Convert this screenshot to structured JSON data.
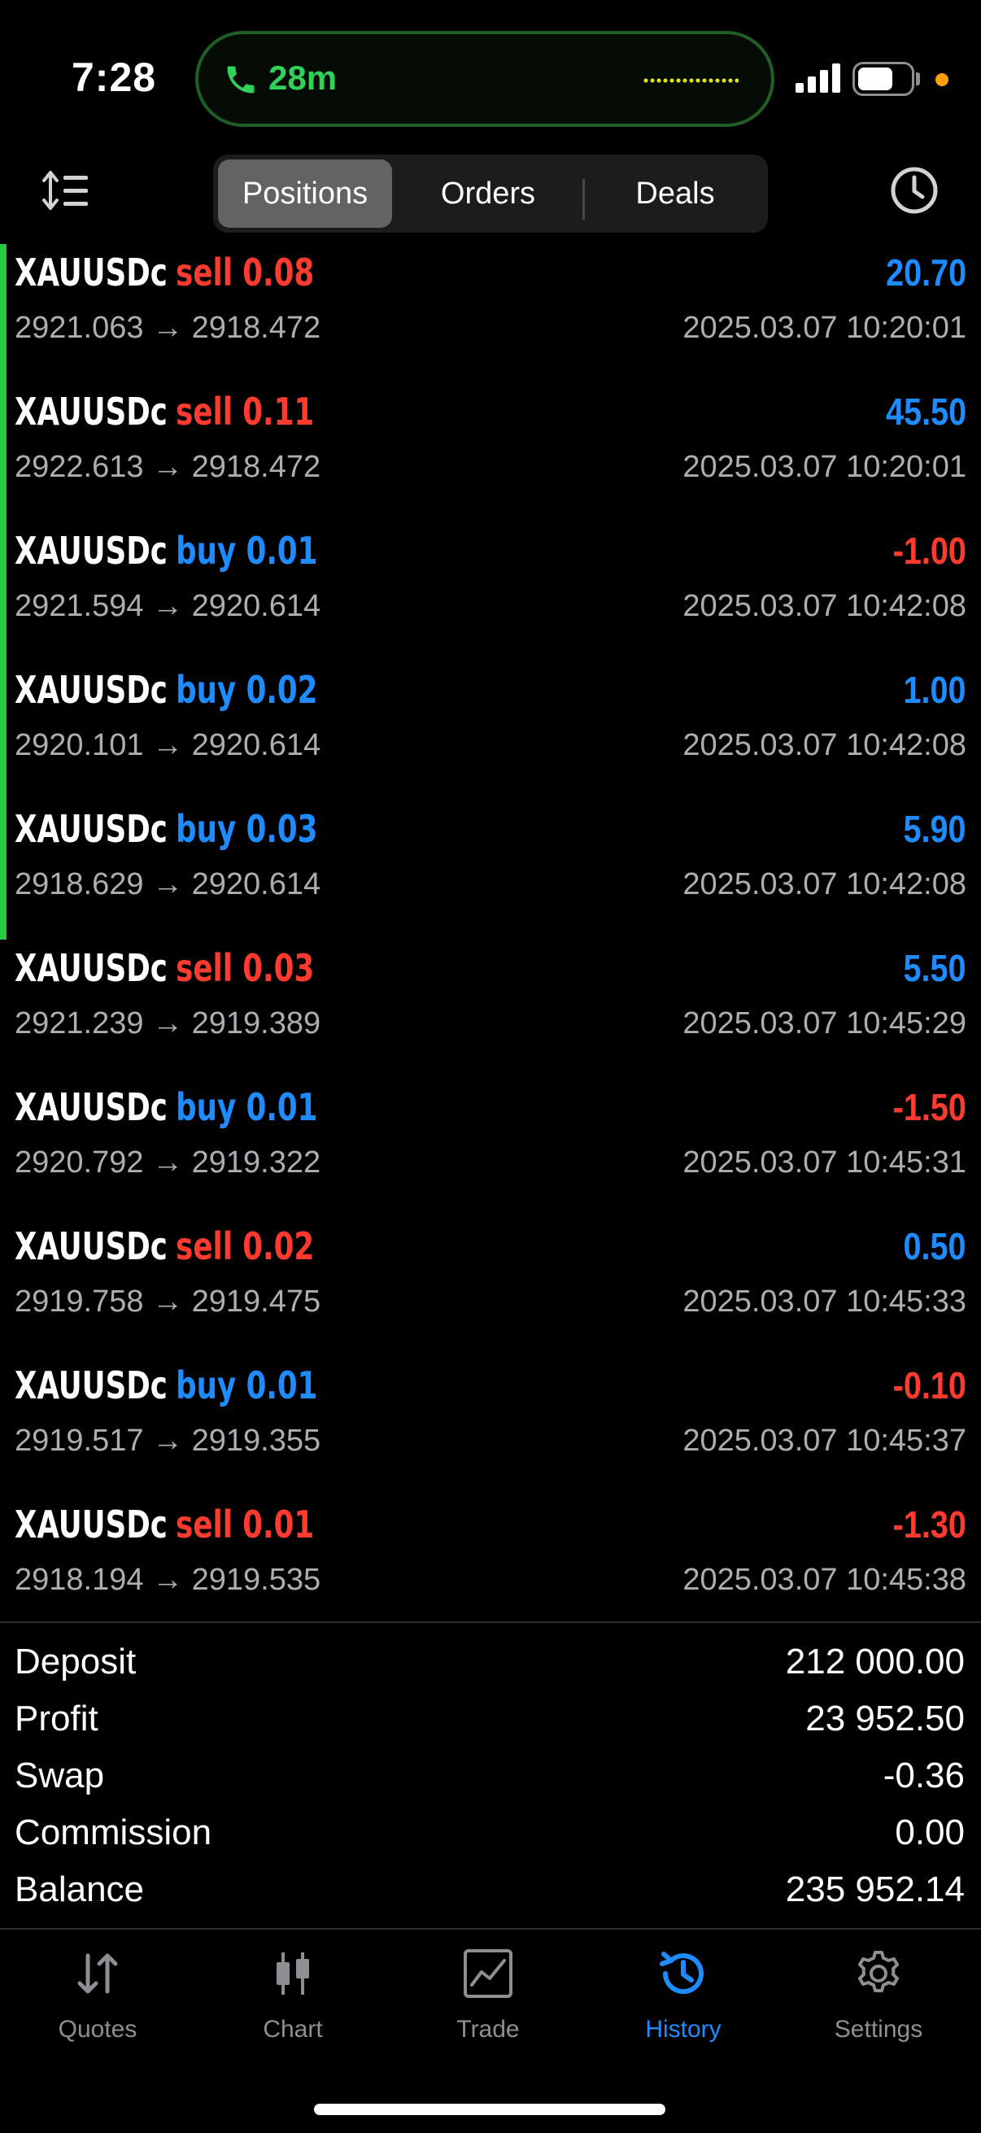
{
  "status_bar": {
    "time": "7:28",
    "call_duration": "28m",
    "icons": [
      "phone-icon",
      "signal-icon",
      "battery-icon",
      "mic-indicator"
    ]
  },
  "header": {
    "sort_icon": "sort-icon",
    "tabs": [
      {
        "label": "Positions",
        "active": true
      },
      {
        "label": "Orders",
        "active": false
      },
      {
        "label": "Deals",
        "active": false
      }
    ],
    "period_icon": "clock-icon"
  },
  "deals": [
    {
      "symbol": "XAUUSDc",
      "side": "sell",
      "volume": "0.08",
      "open": "2921.063",
      "close": "2918.472",
      "profit": "20.70",
      "time": "2025.03.07 10:20:01",
      "highlight": true
    },
    {
      "symbol": "XAUUSDc",
      "side": "sell",
      "volume": "0.11",
      "open": "2922.613",
      "close": "2918.472",
      "profit": "45.50",
      "time": "2025.03.07 10:20:01",
      "highlight": true
    },
    {
      "symbol": "XAUUSDc",
      "side": "buy",
      "volume": "0.01",
      "open": "2921.594",
      "close": "2920.614",
      "profit": "-1.00",
      "time": "2025.03.07 10:42:08",
      "highlight": true
    },
    {
      "symbol": "XAUUSDc",
      "side": "buy",
      "volume": "0.02",
      "open": "2920.101",
      "close": "2920.614",
      "profit": "1.00",
      "time": "2025.03.07 10:42:08",
      "highlight": true
    },
    {
      "symbol": "XAUUSDc",
      "side": "buy",
      "volume": "0.03",
      "open": "2918.629",
      "close": "2920.614",
      "profit": "5.90",
      "time": "2025.03.07 10:42:08",
      "highlight": true
    },
    {
      "symbol": "XAUUSDc",
      "side": "sell",
      "volume": "0.03",
      "open": "2921.239",
      "close": "2919.389",
      "profit": "5.50",
      "time": "2025.03.07 10:45:29",
      "highlight": false
    },
    {
      "symbol": "XAUUSDc",
      "side": "buy",
      "volume": "0.01",
      "open": "2920.792",
      "close": "2919.322",
      "profit": "-1.50",
      "time": "2025.03.07 10:45:31",
      "highlight": false
    },
    {
      "symbol": "XAUUSDc",
      "side": "sell",
      "volume": "0.02",
      "open": "2919.758",
      "close": "2919.475",
      "profit": "0.50",
      "time": "2025.03.07 10:45:33",
      "highlight": false
    },
    {
      "symbol": "XAUUSDc",
      "side": "buy",
      "volume": "0.01",
      "open": "2919.517",
      "close": "2919.355",
      "profit": "-0.10",
      "time": "2025.03.07 10:45:37",
      "highlight": false
    },
    {
      "symbol": "XAUUSDc",
      "side": "sell",
      "volume": "0.01",
      "open": "2918.194",
      "close": "2919.535",
      "profit": "-1.30",
      "time": "2025.03.07 10:45:38",
      "highlight": false
    }
  ],
  "arrow": "→",
  "summary": [
    {
      "label": "Deposit",
      "value": "212 000.00"
    },
    {
      "label": "Profit",
      "value": "23 952.50"
    },
    {
      "label": "Swap",
      "value": "-0.36"
    },
    {
      "label": "Commission",
      "value": "0.00"
    },
    {
      "label": "Balance",
      "value": "235 952.14"
    }
  ],
  "tabbar": [
    {
      "label": "Quotes",
      "icon": "quotes-arrows-icon",
      "active": false
    },
    {
      "label": "Chart",
      "icon": "candlestick-icon",
      "active": false
    },
    {
      "label": "Trade",
      "icon": "trade-chart-icon",
      "active": false
    },
    {
      "label": "History",
      "icon": "history-clock-icon",
      "active": true
    },
    {
      "label": "Settings",
      "icon": "gear-icon",
      "active": false
    }
  ],
  "colors": {
    "sell": "#ff3b30",
    "buy": "#1e8bff",
    "positive_profit": "#1e8bff",
    "negative_profit": "#ff3b30",
    "highlight_bar": "#27c93f",
    "active_tab": "#1e8bff"
  }
}
